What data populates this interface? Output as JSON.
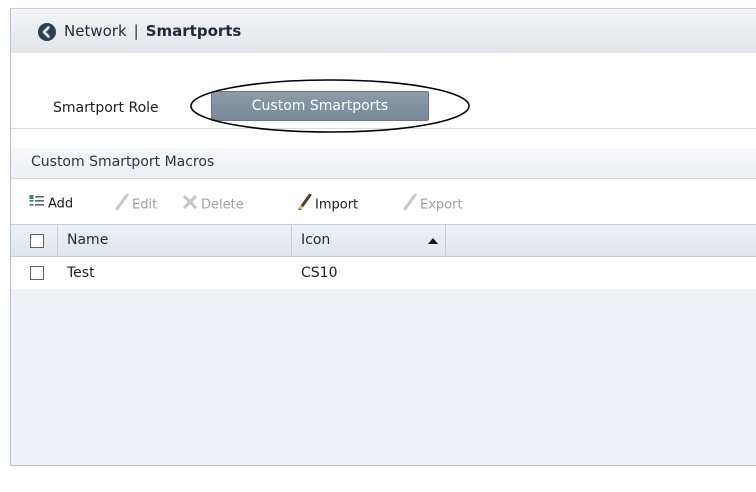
{
  "header": {
    "breadcrumb_parent": "Network",
    "separator": "|",
    "title": "Smartports"
  },
  "role": {
    "label": "Smartport Role",
    "selected": "Custom Smartports"
  },
  "section": {
    "title": "Custom Smartport Macros"
  },
  "toolbar": {
    "add": "Add",
    "edit": "Edit",
    "delete": "Delete",
    "import": "Import",
    "export": "Export"
  },
  "table": {
    "columns": [
      "Name",
      "Icon"
    ],
    "sort": {
      "column": "Icon",
      "direction": "ascending"
    },
    "rows": [
      {
        "name": "Test",
        "icon": "CS10",
        "checked": false
      }
    ]
  },
  "colors": {
    "header_dark": "#2e3f56",
    "role_button": "#7f8d9b",
    "grid_bg": "#eef2f6"
  }
}
